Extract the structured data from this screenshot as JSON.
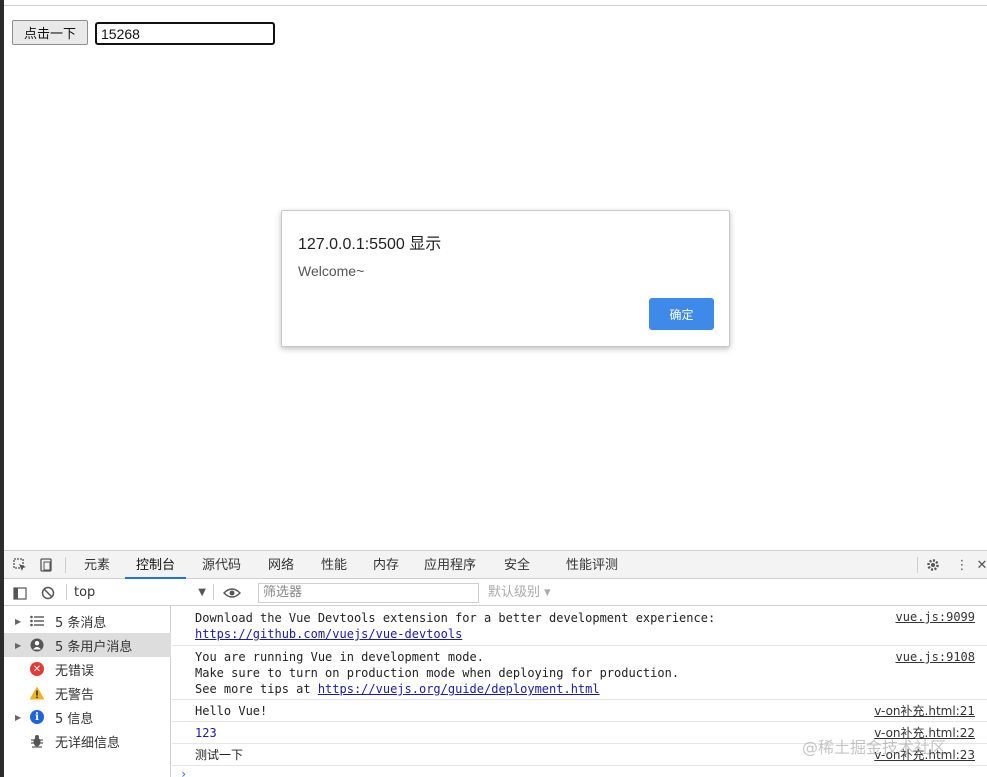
{
  "page": {
    "button_label": "点击一下",
    "input_value": "15268"
  },
  "dialog": {
    "title": "127.0.0.1:5500 显示",
    "message": "Welcome~",
    "ok_label": "确定"
  },
  "devtools": {
    "tabs": [
      "元素",
      "控制台",
      "源代码",
      "网络",
      "性能",
      "内存",
      "应用程序",
      "安全",
      "性能评测"
    ],
    "active_tab": "控制台",
    "context": "top",
    "filter_placeholder": "筛选器",
    "levels": "默认级别 ▾",
    "sidebar": [
      {
        "label": "5 条消息",
        "icon": "list-icon"
      },
      {
        "label": "5 条用户消息",
        "icon": "user-icon"
      },
      {
        "label": "无错误",
        "icon": "error-icon"
      },
      {
        "label": "无警告",
        "icon": "warning-icon"
      },
      {
        "label": "5 信息",
        "icon": "info-icon"
      },
      {
        "label": "无详细信息",
        "icon": "bug-icon"
      }
    ],
    "messages": [
      {
        "lines": [
          "Download the Vue Devtools extension for a better development experience:"
        ],
        "link": "https://github.com/vuejs/vue-devtools",
        "source": "vue.js:9099"
      },
      {
        "lines": [
          "You are running Vue in development mode.",
          "Make sure to turn on production mode when deploying for production."
        ],
        "prefix": "See more tips at ",
        "link": "https://vuejs.org/guide/deployment.html",
        "source": "vue.js:9108"
      },
      {
        "text": "Hello Vue!",
        "source": "v-on补充.html:21"
      },
      {
        "text": "123",
        "source": "v-on补充.html:22"
      },
      {
        "text": "测试一下",
        "source": "v-on补充.html:23"
      }
    ]
  },
  "watermark": "@稀土掘金技术社区"
}
